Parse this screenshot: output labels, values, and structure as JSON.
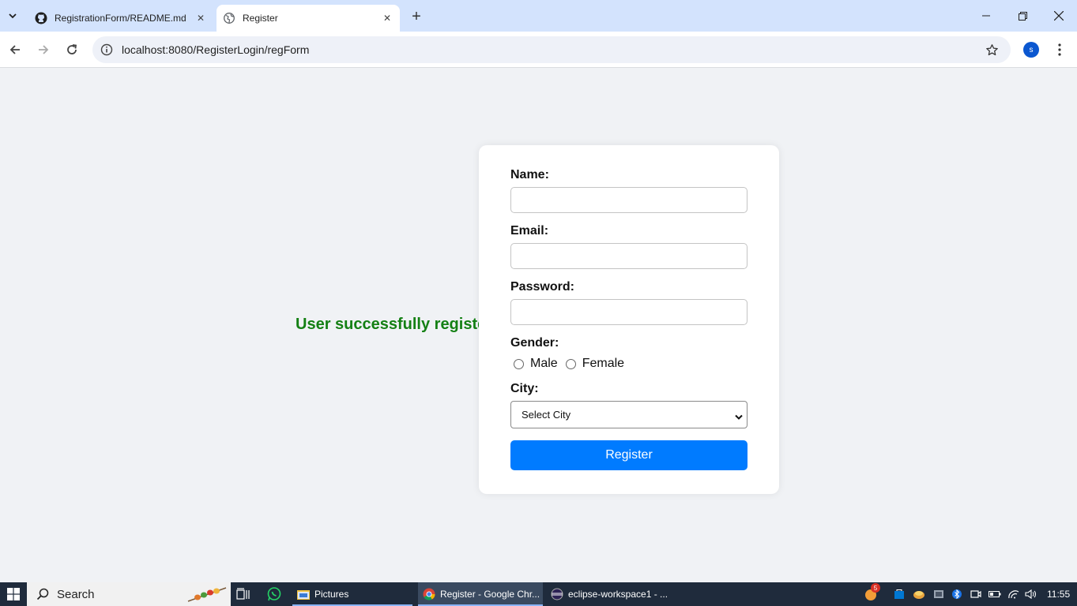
{
  "browser": {
    "tabs": [
      {
        "title": "RegistrationForm/README.md",
        "favicon": "github-icon"
      },
      {
        "title": "Register",
        "favicon": "globe-icon"
      }
    ],
    "url": "localhost:8080/RegisterLogin/regForm",
    "profile_initial": "s"
  },
  "page": {
    "success_message": "User successfully registered",
    "success_color": "#148014",
    "form": {
      "name_label": "Name:",
      "email_label": "Email:",
      "password_label": "Password:",
      "gender_label": "Gender:",
      "gender_options": [
        "Male",
        "Female"
      ],
      "city_label": "City:",
      "city_selected": "Select City",
      "submit_label": "Register",
      "submit_color": "#007bff"
    }
  },
  "taskbar": {
    "search_label": "Search",
    "apps": [
      {
        "label": "Pictures",
        "icon": "explorer-icon"
      },
      {
        "label": "Register - Google Chr...",
        "icon": "chrome-icon"
      },
      {
        "label": "eclipse-workspace1 - ...",
        "icon": "eclipse-icon"
      }
    ],
    "notification_count": "5",
    "time": "11:55"
  }
}
